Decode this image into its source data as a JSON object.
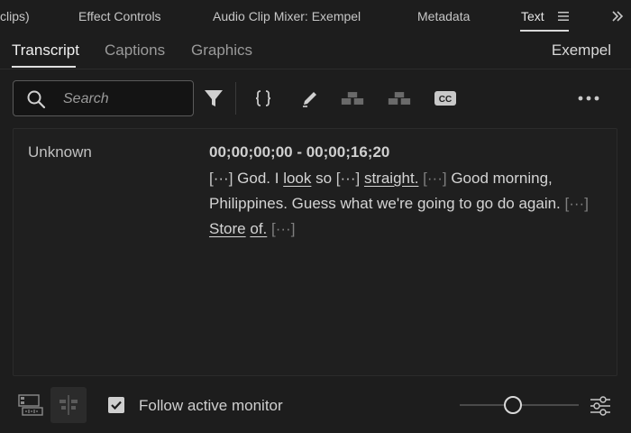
{
  "panel_tabs": [
    {
      "label": "clips)"
    },
    {
      "label": "Effect Controls"
    },
    {
      "label": "Audio Clip Mixer: Exempel"
    },
    {
      "label": "Metadata"
    },
    {
      "label": "Text"
    }
  ],
  "sub_tabs": [
    {
      "label": "Transcript"
    },
    {
      "label": "Captions"
    },
    {
      "label": "Graphics"
    }
  ],
  "sequence_name": "Exempel",
  "search": {
    "placeholder": "Search",
    "value": ""
  },
  "toolbar_icons": [
    "filter-icon",
    "split-segment-icon",
    "edit-pencil-icon",
    "merge-segments-icon",
    "split-speaker-icon",
    "cc-captions-icon",
    "more-options-icon"
  ],
  "transcript": {
    "speaker": "Unknown",
    "timecode": "00;00;00;00 - 00;00;16;20",
    "tokens": [
      {
        "t": "[···]",
        "style": "gapb"
      },
      {
        "t": " God. I ",
        "style": ""
      },
      {
        "t": "look",
        "style": "u"
      },
      {
        "t": " so ",
        "style": ""
      },
      {
        "t": "[···]",
        "style": "gapb"
      },
      {
        "t": " ",
        "style": ""
      },
      {
        "t": "straight.",
        "style": "u"
      },
      {
        "t": " ",
        "style": ""
      },
      {
        "t": "[···]",
        "style": "gap"
      },
      {
        "t": " Good morning, Philippines. Guess what we're going to go do again. ",
        "style": ""
      },
      {
        "t": "[···]",
        "style": "gap"
      },
      {
        "t": " ",
        "style": ""
      },
      {
        "t": "Store",
        "style": "u"
      },
      {
        "t": " ",
        "style": ""
      },
      {
        "t": "of.",
        "style": "u"
      },
      {
        "t": " ",
        "style": ""
      },
      {
        "t": "[···]",
        "style": "gap"
      }
    ]
  },
  "footer": {
    "follow_label": "Follow active monitor",
    "follow_checked": true,
    "zoom_level": 0.45
  },
  "colors": {
    "background": "#1d1d1d",
    "text": "#c8c8c8",
    "accent": "#e0e0e0"
  }
}
